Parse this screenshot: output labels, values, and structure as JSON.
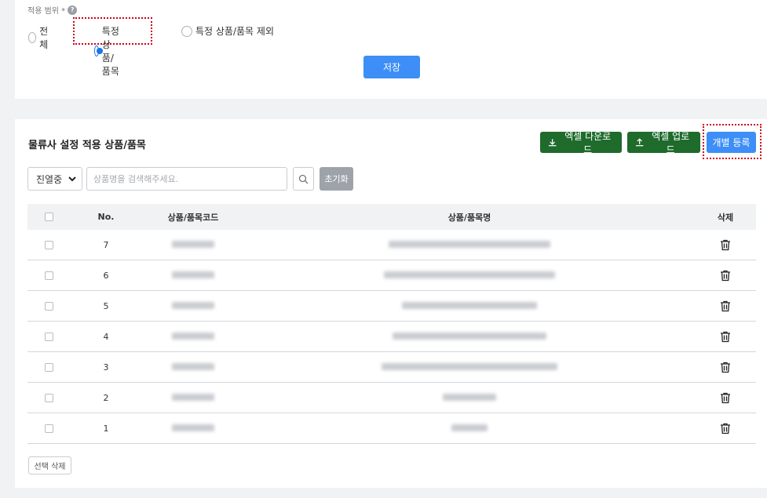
{
  "settings": {
    "scope_label": "적용 범위 *",
    "help_glyph": "?",
    "options": [
      {
        "label": "전체",
        "selected": false
      },
      {
        "label": "특정 상품/품목",
        "selected": true
      },
      {
        "label": "특정 상품/품목 제외",
        "selected": false
      }
    ],
    "save_label": "저장"
  },
  "section": {
    "title": "물류사 설정 적용 상품/품목",
    "excel_download_label": "엑셀 다운로드",
    "excel_upload_label": "엑셀 업로드",
    "register_label": "개별 등록"
  },
  "filter": {
    "status_value": "진열중",
    "search_placeholder": "상품명을 검색해주세요.",
    "reset_label": "초기화"
  },
  "table": {
    "headers": {
      "no": "No.",
      "code": "상품/품목코드",
      "name": "상품/품목명",
      "delete": "삭제"
    },
    "rows": [
      {
        "no": "7",
        "name_width": 0.36
      },
      {
        "no": "6",
        "name_width": 0.38
      },
      {
        "no": "5",
        "name_width": 0.3
      },
      {
        "no": "4",
        "name_width": 0.34
      },
      {
        "no": "3",
        "name_width": 0.39
      },
      {
        "no": "2",
        "name_width": 0.12
      },
      {
        "no": "1",
        "name_width": 0.08
      }
    ]
  },
  "bulk_delete_label": "선택 삭제",
  "colors": {
    "primary": "#3d8ef7",
    "excel_green": "#1e6b2c",
    "highlight": "#d0021b"
  }
}
